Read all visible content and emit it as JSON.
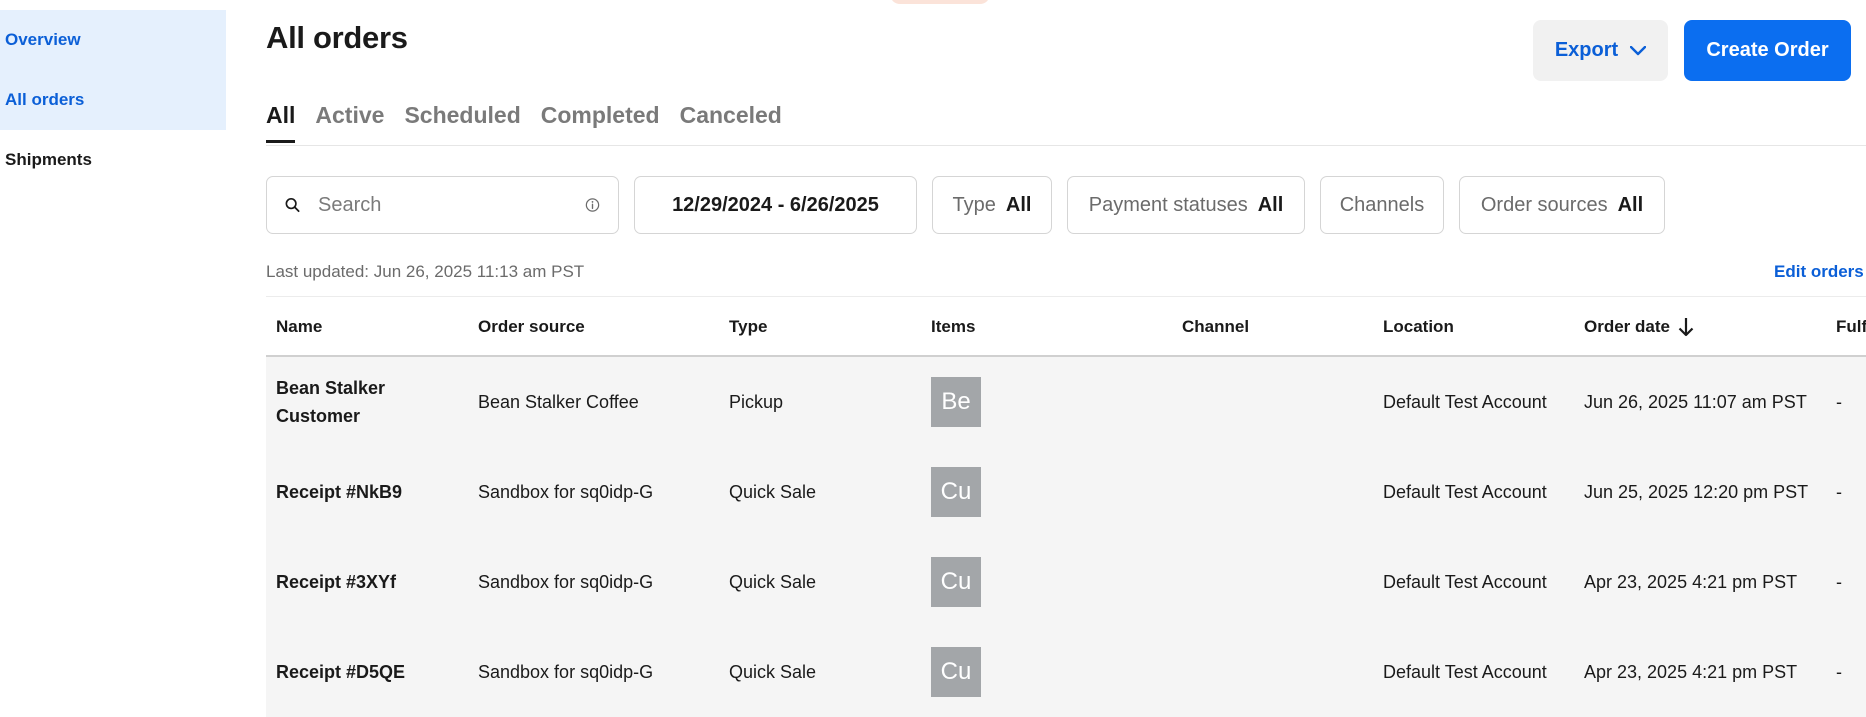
{
  "sidebar": {
    "items": [
      {
        "label": "Overview"
      },
      {
        "label": "All orders"
      },
      {
        "label": "Shipments"
      }
    ]
  },
  "header": {
    "title": "All orders",
    "export_label": "Export",
    "create_label": "Create Order"
  },
  "tabs": [
    {
      "label": "All"
    },
    {
      "label": "Active"
    },
    {
      "label": "Scheduled"
    },
    {
      "label": "Completed"
    },
    {
      "label": "Canceled"
    }
  ],
  "filters": {
    "search_placeholder": "Search",
    "date_range": "12/29/2024 - 6/26/2025",
    "type": {
      "label": "Type",
      "value": "All"
    },
    "payment": {
      "label": "Payment statuses",
      "value": "All"
    },
    "channels": {
      "label": "Channels"
    },
    "sources": {
      "label": "Order sources",
      "value": "All"
    }
  },
  "last_updated": "Last updated: Jun 26, 2025 11:13 am PST",
  "edit_orders": "Edit orders",
  "table": {
    "columns": [
      "Name",
      "Order source",
      "Type",
      "Items",
      "Channel",
      "Location",
      "Order date",
      "Fulf"
    ],
    "rows": [
      {
        "name": "Bean Stalker Customer",
        "source": "Bean Stalker Coffee",
        "type": "Pickup",
        "item": "Be",
        "channel": "",
        "location": "Default Test Account",
        "date": "Jun 26, 2025 11:07 am PST",
        "fulfillment": "-"
      },
      {
        "name": "Receipt #NkB9",
        "source": "Sandbox for sq0idp-G",
        "type": "Quick Sale",
        "item": "Cu",
        "channel": "",
        "location": "Default Test Account",
        "date": "Jun 25, 2025 12:20 pm PST",
        "fulfillment": "-"
      },
      {
        "name": "Receipt #3XYf",
        "source": "Sandbox for sq0idp-G",
        "type": "Quick Sale",
        "item": "Cu",
        "channel": "",
        "location": "Default Test Account",
        "date": "Apr 23, 2025 4:21 pm PST",
        "fulfillment": "-"
      },
      {
        "name": "Receipt #D5QE",
        "source": "Sandbox for sq0idp-G",
        "type": "Quick Sale",
        "item": "Cu",
        "channel": "",
        "location": "Default Test Account",
        "date": "Apr 23, 2025 4:21 pm PST",
        "fulfillment": "-"
      }
    ]
  },
  "colors": {
    "accent": "#0b6ef0",
    "link": "#0b5fd7",
    "sidebar_active_bg": "#e5f0fd",
    "row_bg": "#f5f5f5",
    "thumb_bg": "#a3a6a9"
  },
  "icons": {
    "search": "search-icon",
    "info": "info-icon",
    "export_chevron": "chevron-down-icon",
    "sort": "arrow-down-icon"
  }
}
